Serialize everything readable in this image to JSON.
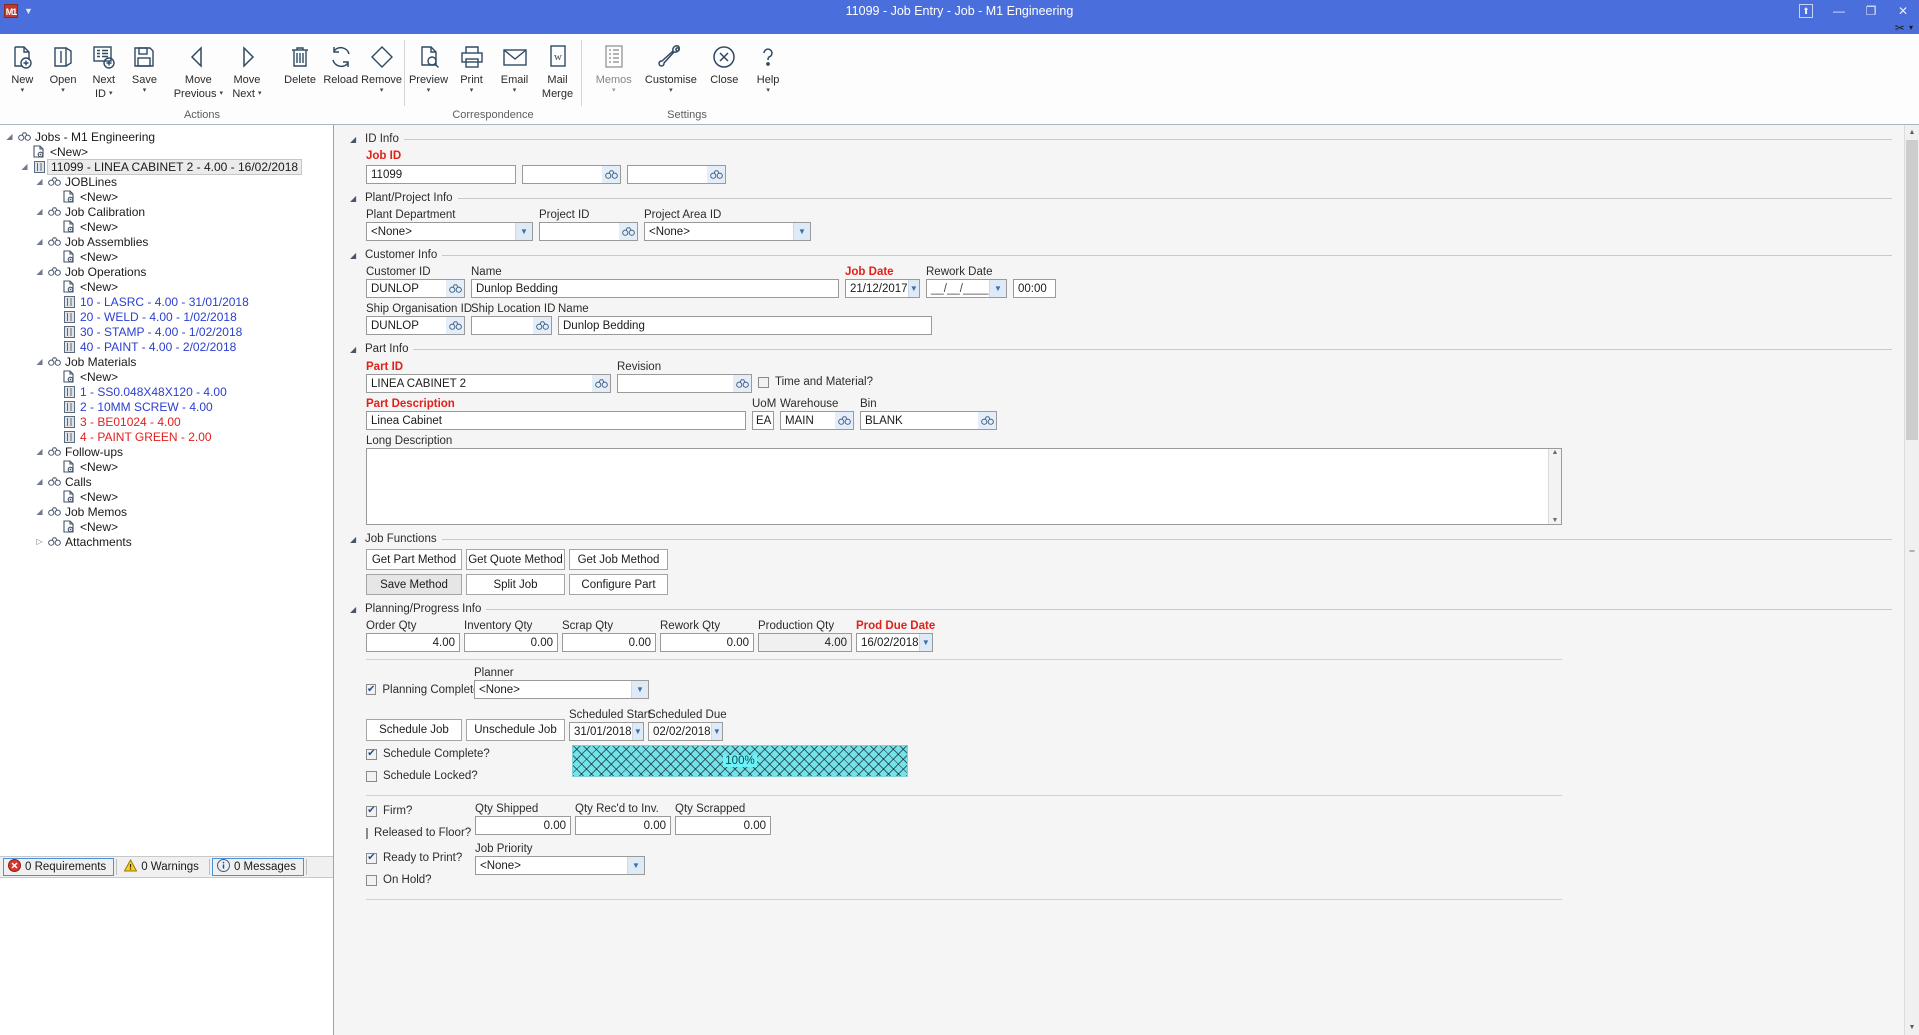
{
  "window": {
    "title": "11099 - Job Entry - Job - M1 Engineering",
    "logo": "M1",
    "restore_up": "⬆",
    "minimize": "—",
    "maximize": "❐",
    "close": "✕",
    "qat_caret": "▼",
    "tools_glyph": "✂",
    "tools_caret": "▾"
  },
  "ribbon": {
    "groups": [
      {
        "title": "Actions",
        "buttons": [
          {
            "label": "New",
            "icon": "new-document-icon",
            "dropdown": "▾"
          },
          {
            "label": "Open",
            "icon": "open-folder-icon",
            "dropdown": "▾"
          },
          {
            "label": "Next\nID",
            "label1": "Next",
            "label2": "ID",
            "icon": "next-id-icon",
            "dropdown": "▾",
            "inline_drop": true
          },
          {
            "label": "Save",
            "icon": "save-disk-icon",
            "dropdown": "▾"
          },
          {
            "label": "Move\nPrevious",
            "label1": "Move",
            "label2": "Previous",
            "icon": "move-previous-icon",
            "dropdown": "▾",
            "inline_drop": true
          },
          {
            "label": "Move\nNext",
            "label1": "Move",
            "label2": "Next",
            "icon": "move-next-icon",
            "dropdown": "▾",
            "inline_drop": true
          },
          {
            "label": "Delete",
            "icon": "delete-trash-icon",
            "dropdown": ""
          },
          {
            "label": "Reload",
            "icon": "reload-refresh-icon",
            "dropdown": ""
          },
          {
            "label": "Remove",
            "icon": "remove-eraser-icon",
            "dropdown": "▾"
          }
        ]
      },
      {
        "title": "Correspondence",
        "buttons": [
          {
            "label": "Preview",
            "icon": "preview-magnifier-icon",
            "dropdown": "▾"
          },
          {
            "label": "Print",
            "icon": "printer-icon",
            "dropdown": "▾"
          },
          {
            "label": "Email",
            "icon": "envelope-icon",
            "dropdown": "▾"
          },
          {
            "label": "Mail\nMerge",
            "label1": "Mail",
            "label2": "Merge",
            "icon": "mail-merge-word-icon",
            "dropdown": ""
          }
        ]
      },
      {
        "title": "Settings",
        "buttons": [
          {
            "label": "Memos",
            "icon": "memos-list-icon",
            "dropdown": "▾",
            "disabled": true
          },
          {
            "label": "Customise",
            "icon": "customise-wrench-icon",
            "dropdown": "▾"
          },
          {
            "label": "Close",
            "icon": "close-circle-icon",
            "dropdown": ""
          },
          {
            "label": "Help",
            "icon": "help-question-icon",
            "dropdown": "▾"
          }
        ]
      }
    ]
  },
  "tree": {
    "nodes": [
      {
        "depth": 0,
        "expander": "◢",
        "icon": "binoculars-icon",
        "label": "Jobs - M1 Engineering",
        "color": "dark"
      },
      {
        "depth": 1,
        "expander": "",
        "icon": "new-record-icon",
        "label": "<New>",
        "color": "dark"
      },
      {
        "depth": 1,
        "expander": "◢",
        "icon": "record-icon",
        "label": "11099 - LINEA CABINET 2 - 4.00 - 16/02/2018",
        "color": "dark",
        "selected": true
      },
      {
        "depth": 2,
        "expander": "◢",
        "icon": "binoculars-icon",
        "label": "JOBLines",
        "color": "dark"
      },
      {
        "depth": 3,
        "expander": "",
        "icon": "new-record-icon",
        "label": "<New>",
        "color": "dark"
      },
      {
        "depth": 2,
        "expander": "◢",
        "icon": "binoculars-icon",
        "label": "Job Calibration",
        "color": "dark"
      },
      {
        "depth": 3,
        "expander": "",
        "icon": "new-record-icon",
        "label": "<New>",
        "color": "dark"
      },
      {
        "depth": 2,
        "expander": "◢",
        "icon": "binoculars-icon",
        "label": "Job Assemblies",
        "color": "dark"
      },
      {
        "depth": 3,
        "expander": "",
        "icon": "new-record-icon",
        "label": "<New>",
        "color": "dark"
      },
      {
        "depth": 2,
        "expander": "◢",
        "icon": "binoculars-icon",
        "label": "Job Operations",
        "color": "dark"
      },
      {
        "depth": 3,
        "expander": "",
        "icon": "new-record-icon",
        "label": "<New>",
        "color": "dark"
      },
      {
        "depth": 3,
        "expander": "",
        "icon": "record-icon",
        "label": "10 - LASRC - 4.00 - 31/01/2018",
        "color": "blue"
      },
      {
        "depth": 3,
        "expander": "",
        "icon": "record-icon",
        "label": "20 - WELD - 4.00 - 1/02/2018",
        "color": "blue"
      },
      {
        "depth": 3,
        "expander": "",
        "icon": "record-icon",
        "label": "30 - STAMP - 4.00 - 1/02/2018",
        "color": "blue"
      },
      {
        "depth": 3,
        "expander": "",
        "icon": "record-icon",
        "label": "40 - PAINT - 4.00 - 2/02/2018",
        "color": "blue"
      },
      {
        "depth": 2,
        "expander": "◢",
        "icon": "binoculars-icon",
        "label": "Job Materials",
        "color": "dark"
      },
      {
        "depth": 3,
        "expander": "",
        "icon": "new-record-icon",
        "label": "<New>",
        "color": "dark"
      },
      {
        "depth": 3,
        "expander": "",
        "icon": "record-icon",
        "label": "1 - SS0.048X48X120 - 4.00",
        "color": "blue"
      },
      {
        "depth": 3,
        "expander": "",
        "icon": "record-icon",
        "label": "2 - 10MM SCREW - 4.00",
        "color": "blue"
      },
      {
        "depth": 3,
        "expander": "",
        "icon": "record-icon",
        "label": "3 - BE01024 - 4.00",
        "color": "red"
      },
      {
        "depth": 3,
        "expander": "",
        "icon": "record-icon",
        "label": "4 - PAINT GREEN - 2.00",
        "color": "red"
      },
      {
        "depth": 2,
        "expander": "◢",
        "icon": "binoculars-icon",
        "label": "Follow-ups",
        "color": "dark"
      },
      {
        "depth": 3,
        "expander": "",
        "icon": "new-record-icon",
        "label": "<New>",
        "color": "dark"
      },
      {
        "depth": 2,
        "expander": "◢",
        "icon": "binoculars-icon",
        "label": "Calls",
        "color": "dark"
      },
      {
        "depth": 3,
        "expander": "",
        "icon": "new-record-icon",
        "label": "<New>",
        "color": "dark"
      },
      {
        "depth": 2,
        "expander": "◢",
        "icon": "binoculars-icon",
        "label": "Job Memos",
        "color": "dark"
      },
      {
        "depth": 3,
        "expander": "",
        "icon": "new-record-icon",
        "label": "<New>",
        "color": "dark"
      },
      {
        "depth": 2,
        "expander": "▷",
        "icon": "binoculars-icon",
        "label": "Attachments",
        "color": "dark"
      }
    ]
  },
  "statusbar": {
    "requirements": "0 Requirements",
    "warnings": "0 Warnings",
    "messages": "0 Messages"
  },
  "form": {
    "id_info": {
      "title": "ID Info",
      "job_id_label": "Job ID",
      "job_id_value": "11099",
      "extra1_value": "",
      "extra2_value": ""
    },
    "plant_project": {
      "title": "Plant/Project Info",
      "plant_department_label": "Plant Department",
      "plant_department_value": "<None>",
      "project_id_label": "Project ID",
      "project_id_value": "",
      "project_area_label": "Project Area ID",
      "project_area_value": "<None>"
    },
    "customer": {
      "title": "Customer Info",
      "customer_id_label": "Customer ID",
      "customer_id_value": "DUNLOP",
      "name_label": "Name",
      "name_value": "Dunlop Bedding",
      "job_date_label": "Job Date",
      "job_date_value": "21/12/2017",
      "rework_date_label": "Rework Date",
      "rework_date_value": "__/__/____",
      "rework_time_value": "00:00",
      "ship_org_label": "Ship Organisation ID",
      "ship_org_value": "DUNLOP",
      "ship_loc_label": "Ship Location ID",
      "ship_loc_value": "",
      "ship_name_label": "Name",
      "ship_name_value": "Dunlop Bedding"
    },
    "part": {
      "title": "Part Info",
      "part_id_label": "Part ID",
      "part_id_value": "LINEA CABINET 2",
      "revision_label": "Revision",
      "revision_value": "",
      "time_material_label": "Time and Material?",
      "time_material_checked": false,
      "part_desc_label": "Part Description",
      "part_desc_value": "Linea Cabinet",
      "uom_label": "UoM",
      "uom_value": "EA",
      "warehouse_label": "Warehouse",
      "warehouse_value": "MAIN",
      "bin_label": "Bin",
      "bin_value": "BLANK",
      "long_desc_label": "Long Description",
      "long_desc_value": ""
    },
    "job_functions": {
      "title": "Job Functions",
      "get_part_method": "Get Part Method",
      "get_quote_method": "Get Quote Method",
      "get_job_method": "Get Job Method",
      "save_method": "Save Method",
      "split_job": "Split Job",
      "configure_part": "Configure Part"
    },
    "planning": {
      "title": "Planning/Progress Info",
      "order_qty_label": "Order Qty",
      "order_qty_value": "4.00",
      "inventory_qty_label": "Inventory Qty",
      "inventory_qty_value": "0.00",
      "scrap_qty_label": "Scrap Qty",
      "scrap_qty_value": "0.00",
      "rework_qty_label": "Rework Qty",
      "rework_qty_value": "0.00",
      "production_qty_label": "Production Qty",
      "production_qty_value": "4.00",
      "prod_due_date_label": "Prod Due Date",
      "prod_due_date_value": "16/02/2018",
      "planning_complete_label": "Planning Complete?",
      "planning_complete_checked": true,
      "planner_label": "Planner",
      "planner_value": "<None>",
      "schedule_job_btn": "Schedule Job",
      "unschedule_job_btn": "Unschedule Job",
      "scheduled_start_label": "Scheduled Start",
      "scheduled_start_value": "31/01/2018",
      "scheduled_due_label": "Scheduled Due",
      "scheduled_due_value": "02/02/2018",
      "schedule_complete_label": "Schedule Complete?",
      "schedule_complete_checked": true,
      "schedule_locked_label": "Schedule Locked?",
      "schedule_locked_checked": false,
      "progress_value": "100%",
      "firm_label": "Firm?",
      "firm_checked": true,
      "released_label": "Released to Floor?",
      "released_checked": false,
      "ready_print_label": "Ready to Print?",
      "ready_print_checked": true,
      "on_hold_label": "On Hold?",
      "on_hold_checked": false,
      "qty_shipped_label": "Qty Shipped",
      "qty_shipped_value": "0.00",
      "qty_recd_label": "Qty Rec'd to Inv.",
      "qty_recd_value": "0.00",
      "qty_scrapped_label": "Qty Scrapped",
      "qty_scrapped_value": "0.00",
      "job_priority_label": "Job Priority",
      "job_priority_value": "<None>"
    }
  },
  "colors": {
    "title_blue": "#4a6fdc",
    "required_red": "#e2201a",
    "tree_blue": "#2b3fd0",
    "tree_red": "#e02020",
    "progress_cyan": "#74e2ea"
  }
}
